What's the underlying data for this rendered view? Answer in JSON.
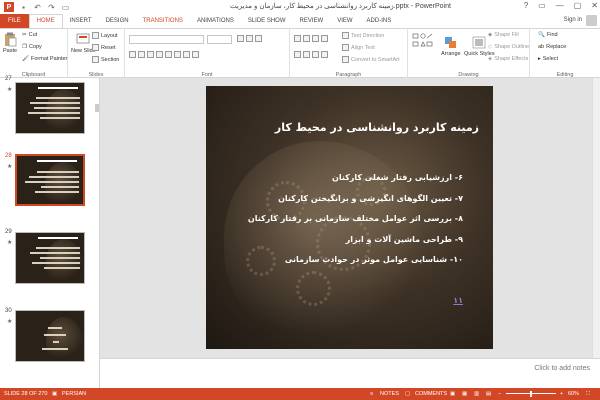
{
  "app": {
    "logo_letter": "P",
    "title": "زمینه کاربرد روانشناسی در محیط کار، سازمان و مدیریت.pptx - PowerPoint",
    "accent": "#d24726",
    "window_controls": [
      "?",
      "▭",
      "—",
      "▢",
      "✕"
    ]
  },
  "quick_access": [
    "save-icon",
    "undo-icon",
    "redo-icon",
    "present-icon"
  ],
  "tabs": [
    {
      "label": "FILE"
    },
    {
      "label": "HOME"
    },
    {
      "label": "INSERT"
    },
    {
      "label": "DESIGN"
    },
    {
      "label": "TRANSITIONS"
    },
    {
      "label": "ANIMATIONS"
    },
    {
      "label": "SLIDE SHOW"
    },
    {
      "label": "REVIEW"
    },
    {
      "label": "VIEW"
    },
    {
      "label": "ADD-INS"
    }
  ],
  "signin": "Sign in",
  "ribbon": {
    "clipboard": {
      "label": "Clipboard",
      "paste": "Paste",
      "cut": "Cut",
      "copy": "Copy",
      "format_painter": "Format Painter"
    },
    "slides": {
      "label": "Slides",
      "new_slide": "New Slide",
      "layout": "Layout",
      "reset": "Reset",
      "section": "Section"
    },
    "font": {
      "label": "Font"
    },
    "paragraph": {
      "label": "Paragraph",
      "text_direction": "Text Direction",
      "align_text": "Align Text",
      "convert": "Convert to SmartArt"
    },
    "drawing": {
      "label": "Drawing",
      "arrange": "Arrange",
      "quick_styles": "Quick Styles",
      "shape_fill": "Shape Fill",
      "shape_outline": "Shape Outline",
      "shape_effects": "Shape Effects"
    },
    "editing": {
      "label": "Editing",
      "find": "Find",
      "replace": "Replace",
      "select": "Select"
    }
  },
  "thumbnails": [
    {
      "number": "27",
      "star": "★"
    },
    {
      "number": "28",
      "star": "★"
    },
    {
      "number": "29",
      "star": "★"
    },
    {
      "number": "30",
      "star": "★"
    }
  ],
  "slide": {
    "title": "زمینه کاربرد روانشناسی در محیط کار",
    "items": [
      "۶- ارزشیابی رفتار شغلی کارکنان",
      "۷- تعیین الگوهای انگیزشی و برانگیختن کارکنان",
      "۸- بررسی اثر عوامل مختلف سازمانی بر رفتار کارکنان",
      "۹- طراحی ماشین آلات و ابزار",
      "۱۰- شناسایی عوامل موثر در حوادث سازمانی"
    ],
    "link": "۱۱"
  },
  "notes_placeholder": "Click to add notes",
  "status": {
    "slide_info": "SLIDE 28 OF 270",
    "language": "PERSIAN",
    "notes": "NOTES",
    "comments": "COMMENTS",
    "zoom": "60%"
  }
}
